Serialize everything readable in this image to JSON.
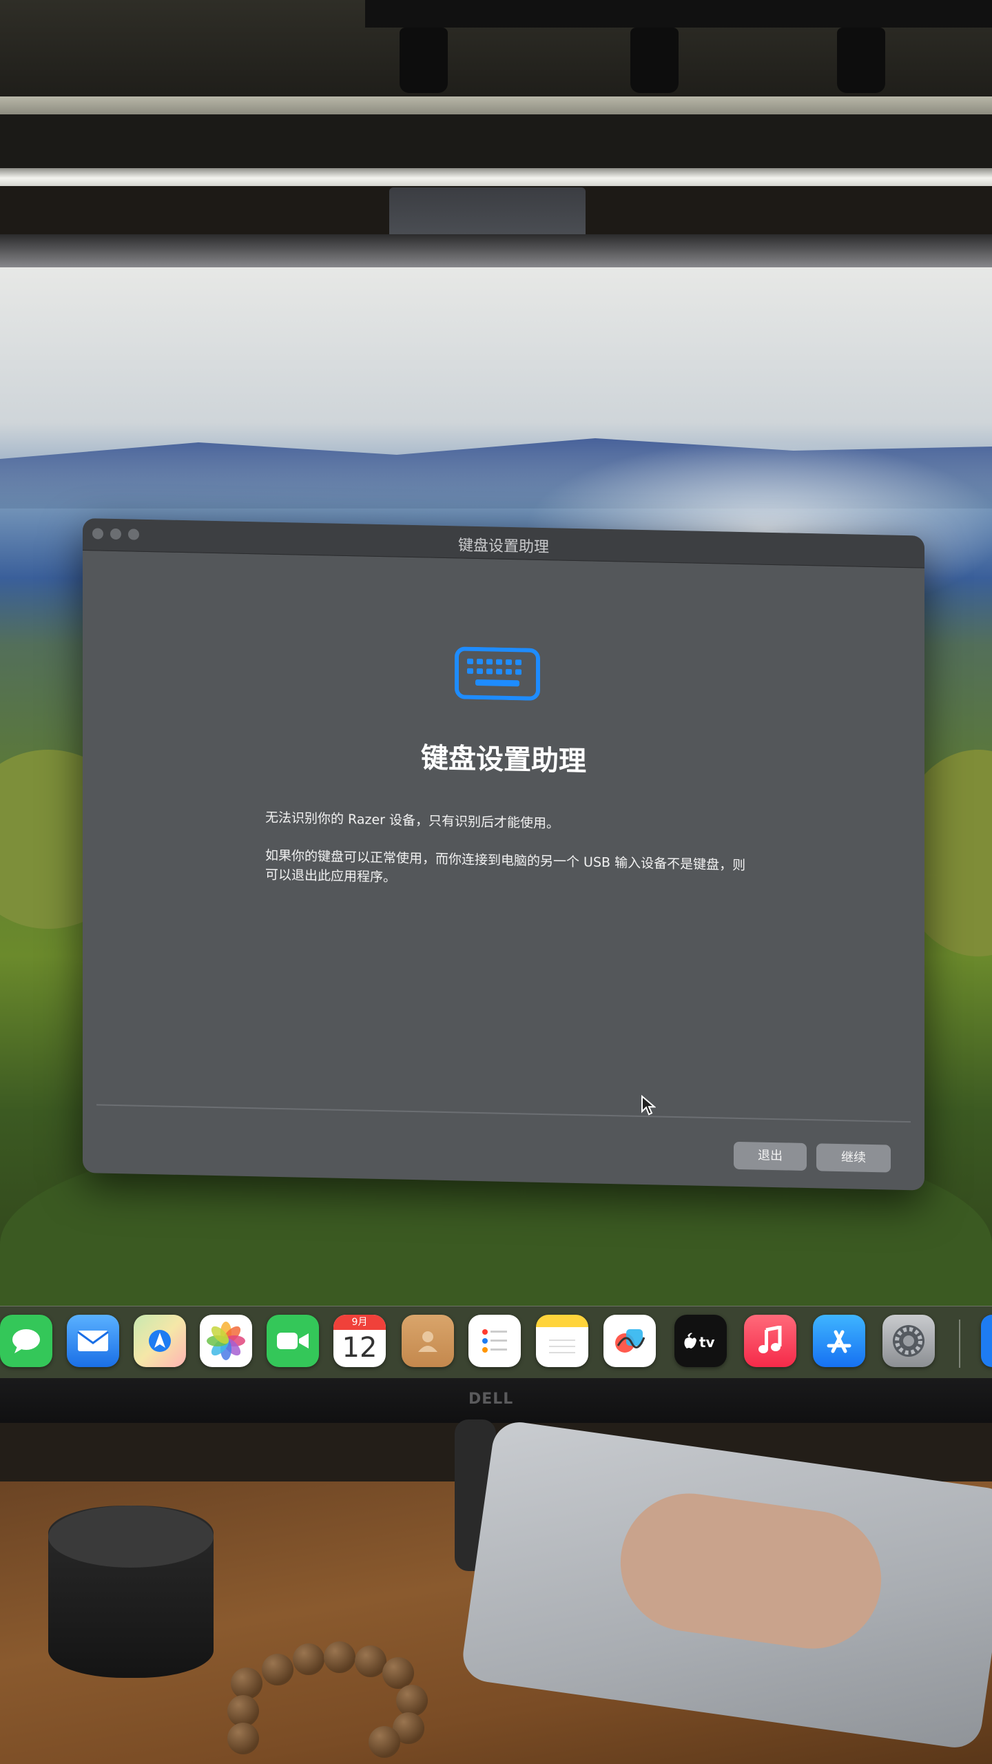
{
  "window": {
    "title": "键盘设置助理",
    "heading": "键盘设置助理",
    "message_1": "无法识别你的 Razer 设备，只有识别后才能使用。",
    "message_2": "如果你的键盘可以正常使用，而你连接到电脑的另一个 USB 输入设备不是键盘，则可以退出此应用程序。",
    "quit_label": "退出",
    "continue_label": "继续"
  },
  "dock": {
    "calendar_month": "9月",
    "calendar_day": "12",
    "items": [
      "messages-icon",
      "mail-icon",
      "maps-icon",
      "photos-icon",
      "facetime-icon",
      "calendar-icon",
      "contacts-icon",
      "reminders-icon",
      "notes-icon",
      "freeform-icon",
      "tv-icon",
      "music-icon",
      "app-store-icon",
      "system-settings-icon"
    ]
  },
  "monitor": {
    "brand": "DELL"
  },
  "colors": {
    "accent_blue": "#1e8cff",
    "window_bg": "#54575a",
    "button_bg": "#8d9095"
  }
}
